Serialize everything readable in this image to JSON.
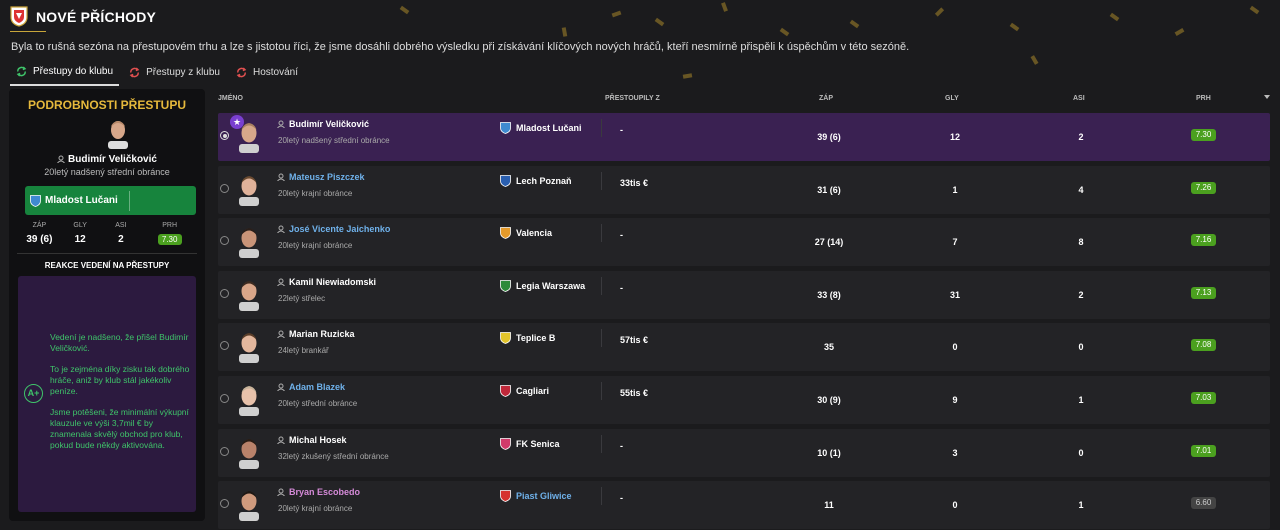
{
  "header": {
    "title": "NOVÉ PŘÍCHODY",
    "subtitle": "Byla to rušná sezóna na přestupovém trhu a lze s jistotou říci, že jsme dosáhli dobrého výsledku při získávání klíčových nových hráčů, kteří nesmírně přispěli k úspěchům v této sezóně."
  },
  "tabs": [
    {
      "label": "Přestupy do klubu",
      "active": true
    },
    {
      "label": "Přestupy z klubu",
      "active": false
    },
    {
      "label": "Hostování",
      "active": false
    }
  ],
  "panel": {
    "title": "PODROBNOSTI PŘESTUPU",
    "player_name": "Budimír Veličković",
    "player_desc": "20letý nadšený střední obránce",
    "club": "Mladost Lučani",
    "fee": "-",
    "stats": [
      {
        "label": "ZÁP",
        "value": "39 (6)"
      },
      {
        "label": "GLY",
        "value": "12"
      },
      {
        "label": "ASI",
        "value": "2"
      },
      {
        "label": "PRH",
        "value": "7.30"
      }
    ],
    "reaction_title": "REAKCE VEDENÍ NA PŘESTUPY",
    "grade": "A+",
    "reactions": [
      "Vedení je nadšeno, že přišel Budimír Veličković.",
      "To je zejména díky zisku tak dobrého hráče, aniž by klub stál jakékoliv peníze.",
      "Jsme potěšeni, že minimální výkupní klauzule ve výši 3,7mil € by znamenala skvělý obchod pro klub, pokud bude někdy aktivována."
    ]
  },
  "table": {
    "columns": {
      "name": "JMÉNO",
      "from": "PŘESTOUPILY Z",
      "apps": "ZÁP",
      "goals": "GLY",
      "assists": "ASI",
      "rating": "PRH"
    },
    "rows": [
      {
        "name": "Budimír Veličković",
        "desc": "20letý nadšený střední obránce",
        "club": "Mladost Lučani",
        "fee": "-",
        "apps": "39 (6)",
        "goals": "12",
        "assists": "2",
        "rating": "7.30",
        "selected": true,
        "name_color": "white",
        "club_color": "white",
        "badge": "#3f8ad0"
      },
      {
        "name": "Mateusz Piszczek",
        "desc": "20letý krajní obránce",
        "club": "Lech Poznaň",
        "fee": "33tis €",
        "apps": "31 (6)",
        "goals": "1",
        "assists": "4",
        "rating": "7.26",
        "name_color": "blue",
        "club_color": "white",
        "badge": "#2a5fb0"
      },
      {
        "name": "José Vicente Jaichenko",
        "desc": "20letý krajní obránce",
        "club": "Valencia",
        "fee": "-",
        "apps": "27 (14)",
        "goals": "7",
        "assists": "8",
        "rating": "7.16",
        "name_color": "blue",
        "club_color": "white",
        "badge": "#e59a2a"
      },
      {
        "name": "Kamil Niewiadomski",
        "desc": "22letý střelec",
        "club": "Legia Warszawa",
        "fee": "-",
        "apps": "33 (8)",
        "goals": "31",
        "assists": "2",
        "rating": "7.13",
        "name_color": "white",
        "club_color": "white",
        "badge": "#2e8a3a"
      },
      {
        "name": "Marian Ruzicka",
        "desc": "24letý brankář",
        "club": "Teplice B",
        "fee": "57tis €",
        "apps": "35",
        "goals": "0",
        "assists": "0",
        "rating": "7.08",
        "name_color": "white",
        "club_color": "white",
        "badge": "#e2c42a"
      },
      {
        "name": "Adam Blazek",
        "desc": "20letý střední obránce",
        "club": "Cagliari",
        "fee": "55tis €",
        "apps": "30 (9)",
        "goals": "9",
        "assists": "1",
        "rating": "7.03",
        "name_color": "blue",
        "club_color": "white",
        "badge": "#c0283a"
      },
      {
        "name": "Michal Hosek",
        "desc": "32letý zkušený střední obránce",
        "club": "FK Senica",
        "fee": "-",
        "apps": "10 (1)",
        "goals": "3",
        "assists": "0",
        "rating": "7.01",
        "name_color": "white",
        "club_color": "white",
        "badge": "#d03a6a"
      },
      {
        "name": "Bryan Escobedo",
        "desc": "20letý krajní obránce",
        "club": "Piast Gliwice",
        "fee": "-",
        "apps": "11",
        "goals": "0",
        "assists": "1",
        "rating": "6.60",
        "name_color": "pink",
        "club_color": "blue",
        "badge": "#d6332f",
        "rating_grey": true
      }
    ]
  }
}
